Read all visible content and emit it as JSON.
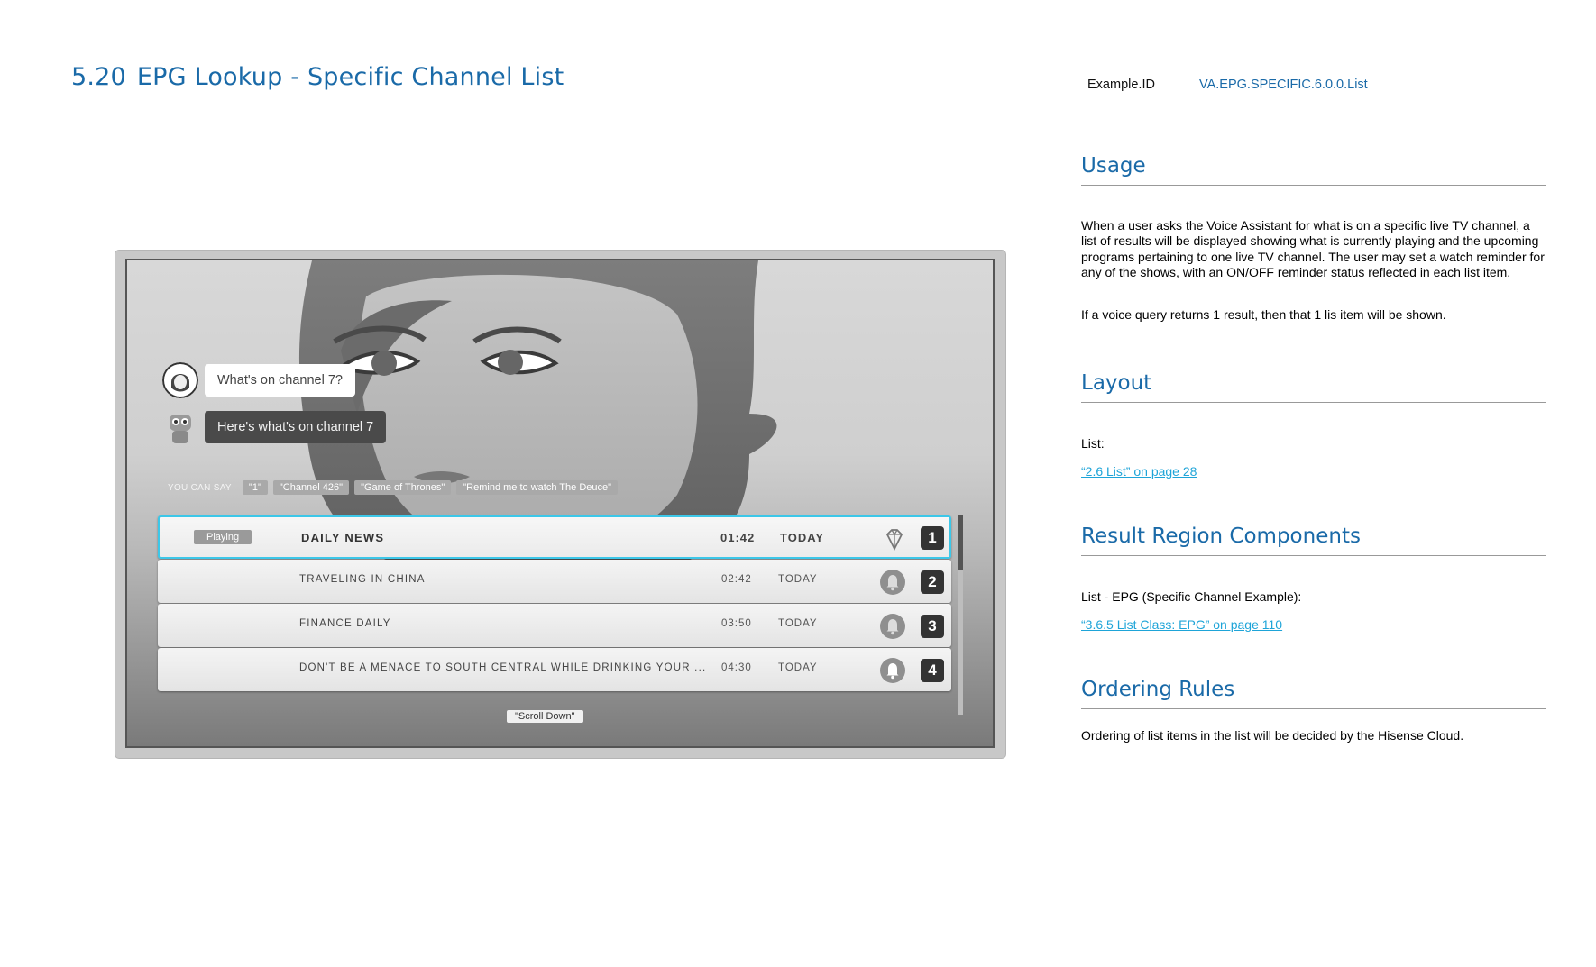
{
  "header": {
    "section_number": "5.20",
    "title": "EPG Lookup - Specific Channel List",
    "example_id_label": "Example.ID",
    "example_id_value": "VA.EPG.SPECIFIC.6.0.0.List"
  },
  "usage": {
    "heading": "Usage",
    "paragraph1": "When a user asks the Voice Assistant for what is on a specific live TV channel, a list of results will be displayed showing what is currently playing and the upcoming programs pertaining to one live TV channel. The user may set a watch reminder for any of the shows, with an ON/OFF reminder status reflected in each list item.",
    "paragraph2": "If a voice query returns 1 result, then that 1 lis item will be shown."
  },
  "layout": {
    "heading": "Layout",
    "label": "List:",
    "link": "“2.6 List” on page 28"
  },
  "result_region": {
    "heading": "Result Region Components",
    "label": "List - EPG (Specific Channel Example):",
    "link": "“3.6.5 List Class: EPG” on page 110"
  },
  "ordering": {
    "heading": "Ordering Rules",
    "text": "Ordering of list items in the list will be decided by the Hisense Cloud."
  },
  "tv": {
    "user_query": "What's on channel 7?",
    "assistant_reply": "Here's what's on channel 7",
    "you_can_say_label": "YOU CAN SAY",
    "suggestions": [
      "\"1\"",
      "\"Channel 426\"",
      "\"Game of Thrones\"",
      "\"Remind me to watch The Deuce\""
    ],
    "scroll_hint": "\"Scroll Down\"",
    "playing_badge": "Playing",
    "rows": [
      {
        "title": "DAILY NEWS",
        "time": "01:42",
        "day": "TODAY",
        "number": "1",
        "icon": "diamond-icon",
        "playing": true
      },
      {
        "title": "TRAVELING IN CHINA",
        "time": "02:42",
        "day": "TODAY",
        "number": "2",
        "icon": "bell-icon",
        "playing": false
      },
      {
        "title": "FINANCE DAILY",
        "time": "03:50",
        "day": "TODAY",
        "number": "3",
        "icon": "bell-icon",
        "playing": false
      },
      {
        "title": "DON'T BE A MENACE TO SOUTH CENTRAL WHILE DRINKING YOUR ...",
        "time": "04:30",
        "day": "TODAY",
        "number": "4",
        "icon": "bell-icon",
        "playing": false
      }
    ]
  },
  "colors": {
    "heading_blue": "#1a6aa8",
    "link_blue": "#1ea4d8",
    "selection_cyan": "#3cc7e8"
  }
}
